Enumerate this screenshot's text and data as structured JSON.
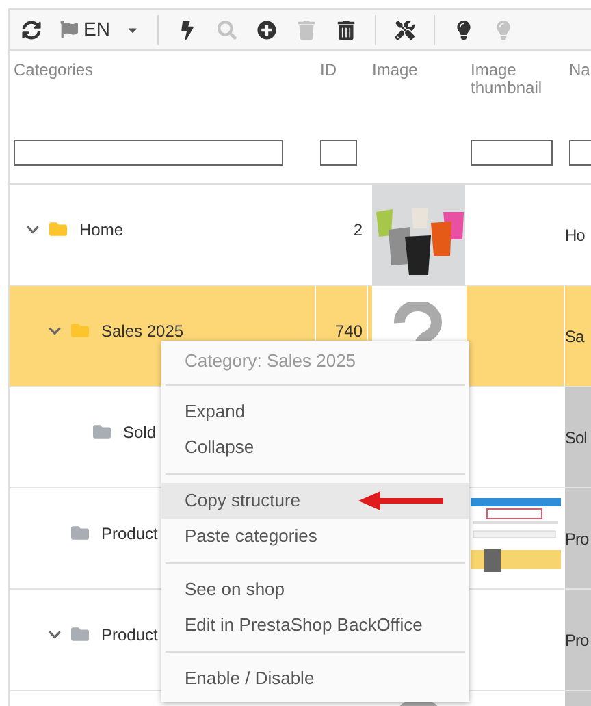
{
  "toolbar": {
    "language": "EN",
    "buttons": [
      {
        "kind": "refresh",
        "disabled": false
      },
      {
        "kind": "language"
      },
      {
        "kind": "separator"
      },
      {
        "kind": "bolt",
        "disabled": false
      },
      {
        "kind": "search",
        "disabled": true
      },
      {
        "kind": "add",
        "disabled": false
      },
      {
        "kind": "trash",
        "disabled": true
      },
      {
        "kind": "bin",
        "disabled": false
      },
      {
        "kind": "separator"
      },
      {
        "kind": "tools",
        "disabled": false
      },
      {
        "kind": "separator"
      },
      {
        "kind": "bulb-on",
        "disabled": false
      },
      {
        "kind": "bulb-off",
        "disabled": true
      }
    ]
  },
  "table": {
    "columns": [
      {
        "label": "Categories",
        "filter": true
      },
      {
        "label": "ID",
        "filter": true
      },
      {
        "label": "Image",
        "filter": false
      },
      {
        "label": "Image thumbnail",
        "filter": true
      },
      {
        "label": "Na",
        "filter": true
      }
    ],
    "rows": [
      {
        "name": "Home",
        "id": "2",
        "image": {
          "kind": "picture"
        },
        "name_cell": "Ho",
        "expanded": true,
        "color": "#fcc52e",
        "selected": false,
        "highlighted": false,
        "children": [
          {
            "name": "Sales 2025",
            "id": "740",
            "image": {
              "kind": "placeholder"
            },
            "name_cell": "Sa",
            "expanded": true,
            "color": "#fcc52e",
            "selected": true,
            "highlighted": false,
            "children": [
              {
                "name": "Sold",
                "name_cell": "Sol",
                "color": "#a9adb4",
                "selected": false,
                "highlighted": true
              }
            ]
          },
          {
            "name": "Product",
            "thumbnail": {
              "kind": "picture"
            },
            "name_cell": "Pro",
            "color": "#a9adb4",
            "selected": false,
            "highlighted": true
          },
          {
            "name": "Product",
            "name_cell": "Pro",
            "expanded": true,
            "color": "#a9adb4",
            "selected": false,
            "highlighted": true
          }
        ]
      },
      {
        "image": {
          "kind": "placeholder"
        },
        "selected": false,
        "highlighted": true
      }
    ]
  },
  "context_menu": {
    "title": "Category: Sales 2025",
    "groups": [
      [
        {
          "label": "Expand",
          "selected": false
        },
        {
          "label": "Collapse",
          "selected": false
        }
      ],
      [
        {
          "label": "Copy structure",
          "selected": true
        },
        {
          "label": "Paste categories",
          "selected": false
        }
      ],
      [
        {
          "label": "See on shop",
          "selected": false
        },
        {
          "label": "Edit in PrestaShop BackOffice",
          "selected": false
        }
      ],
      [
        {
          "label": "Enable / Disable",
          "selected": false
        }
      ]
    ]
  }
}
